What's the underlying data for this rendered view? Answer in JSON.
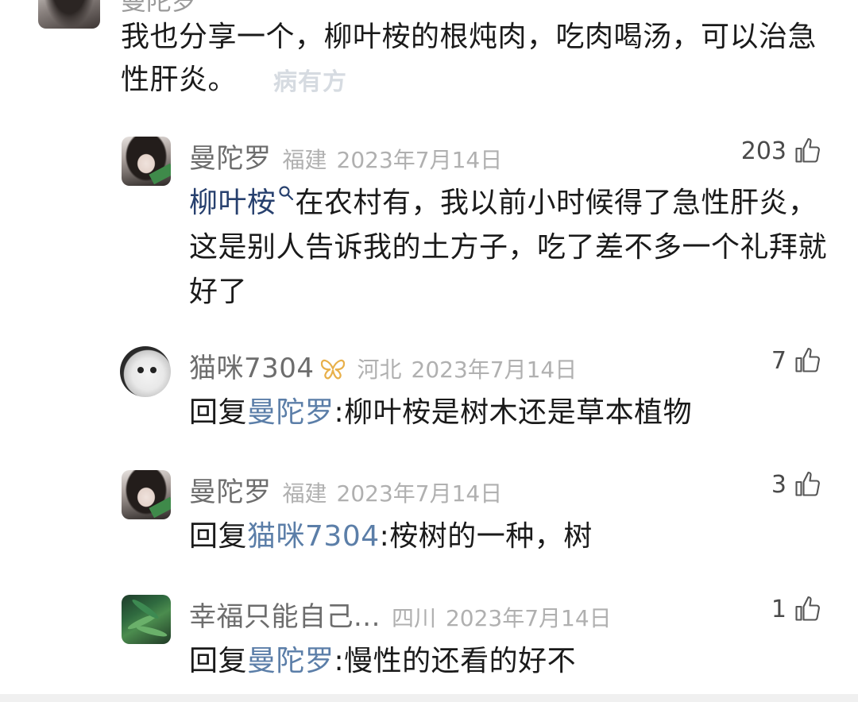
{
  "top_comment": {
    "name": "曼陀罗",
    "text": "我也分享一个，柳叶桉的根炖肉，吃肉喝汤，可以治急性肝炎。",
    "watermark": "病有方"
  },
  "replies": [
    {
      "name": "曼陀罗",
      "region": "福建",
      "date": "2023年7月14日",
      "likes": "203",
      "link_text": "柳叶桉",
      "text": "在农村有，我以前小时候得了急性肝炎，这是别人告诉我的土方子，吃了差不多一个礼拜就好了"
    },
    {
      "name": "猫咪7304",
      "region": "河北",
      "date": "2023年7月14日",
      "likes": "7",
      "reply_prefix": "回复",
      "mention": "曼陀罗",
      "text": ":柳叶桉是树木还是草本植物"
    },
    {
      "name": "曼陀罗",
      "region": "福建",
      "date": "2023年7月14日",
      "likes": "3",
      "reply_prefix": "回复",
      "mention": "猫咪7304",
      "text": ":桉树的一种，树"
    },
    {
      "name": "幸福只能自己...",
      "region": "四川",
      "date": "2023年7月14日",
      "likes": "1",
      "reply_prefix": "回复",
      "mention": "曼陀罗",
      "text": ":慢性的还看的好不"
    }
  ],
  "colors": {
    "link": "#27406e",
    "mention": "#5b7ea8",
    "badge": "#e8b04a"
  },
  "icons": [
    "thumbs-up-icon",
    "search-icon",
    "butterfly-badge-icon"
  ]
}
